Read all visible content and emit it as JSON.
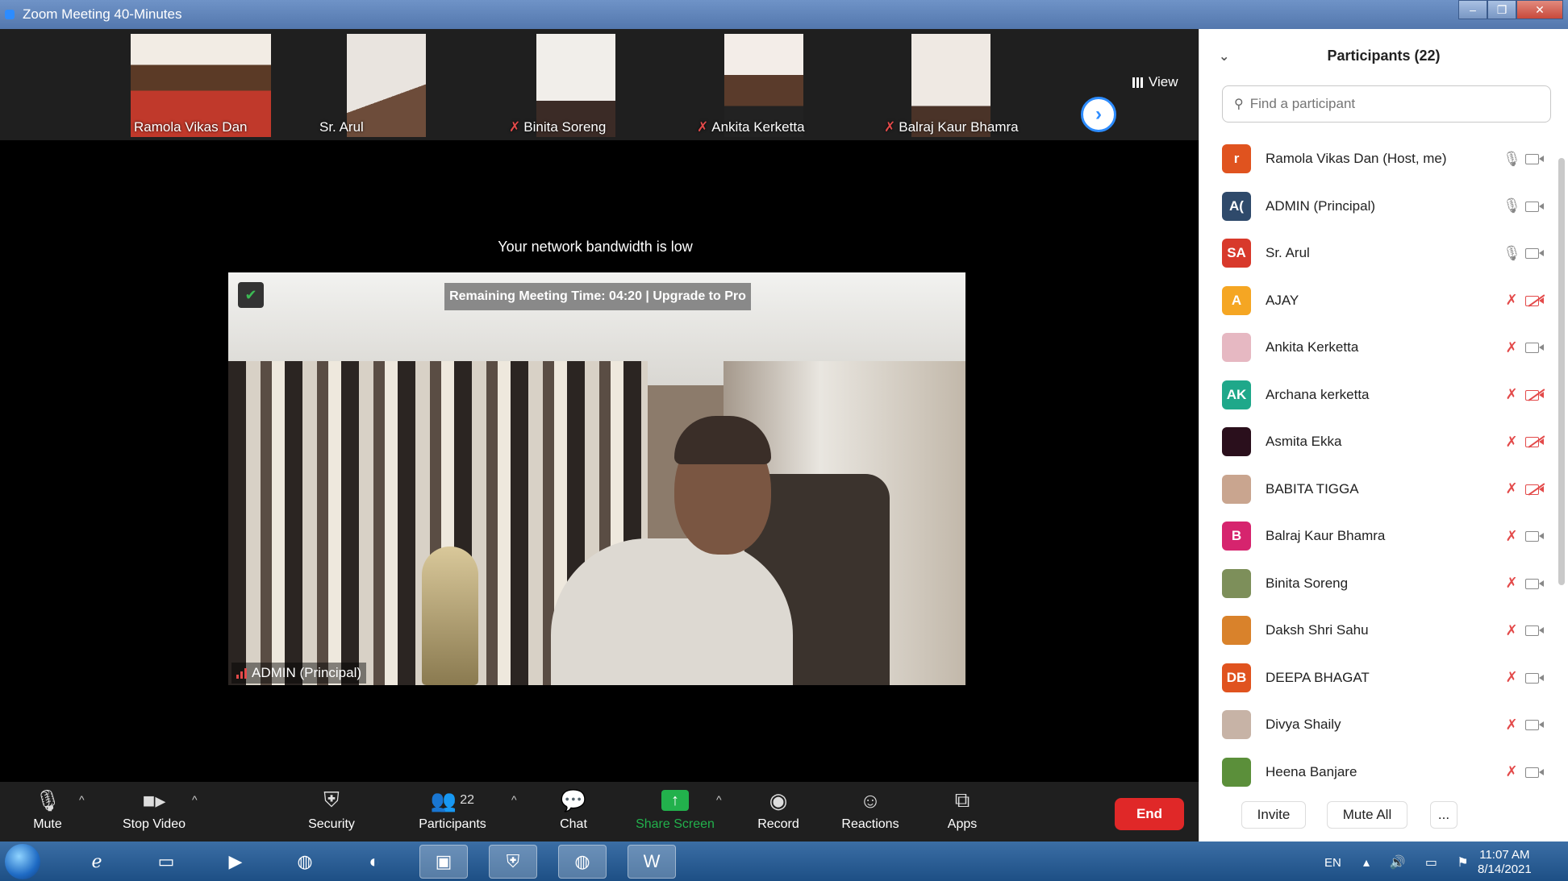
{
  "window": {
    "title": "Zoom Meeting 40-Minutes",
    "controls": [
      "–",
      "❐",
      "✕"
    ]
  },
  "gallery": {
    "tiles": [
      {
        "name": "Ramola  Vikas Dan",
        "muted": false
      },
      {
        "name": "Sr. Arul",
        "muted": false
      },
      {
        "name": "Binita Soreng",
        "muted": true
      },
      {
        "name": "Ankita Kerketta",
        "muted": true
      },
      {
        "name": "Balraj Kaur Bhamra",
        "muted": true
      }
    ],
    "view_label": "View"
  },
  "stage": {
    "bandwidth_notice": "Your network bandwidth is low",
    "remaining_time": "Remaining Meeting Time: 04:20 | Upgrade to Pro",
    "active_speaker": "ADMIN (Principal)"
  },
  "toolbar": {
    "mute": "Mute",
    "stop_video": "Stop Video",
    "security": "Security",
    "participants": "Participants",
    "participants_count": "22",
    "chat": "Chat",
    "share_screen": "Share Screen",
    "record": "Record",
    "reactions": "Reactions",
    "apps": "Apps",
    "end": "End"
  },
  "panel": {
    "title": "Participants (22)",
    "search_placeholder": "Find a participant",
    "participants": [
      {
        "initials": "r",
        "name": "Ramola  Vikas Dan (Host, me)",
        "color": "#e0531f",
        "mic": "on",
        "cam": "on"
      },
      {
        "initials": "A(",
        "name": "ADMIN (Principal)",
        "color": "#2f4a6b",
        "mic": "on",
        "cam": "on"
      },
      {
        "initials": "SA",
        "name": "Sr. Arul",
        "color": "#d8392b",
        "mic": "on",
        "cam": "on"
      },
      {
        "initials": "A",
        "name": "AJAY",
        "color": "#f5a623",
        "mic": "off",
        "cam": "off"
      },
      {
        "initials": "",
        "name": "Ankita Kerketta",
        "color": "#e6b8c2",
        "mic": "off",
        "cam": "on"
      },
      {
        "initials": "AK",
        "name": "Archana kerketta",
        "color": "#1fa88a",
        "mic": "off",
        "cam": "off"
      },
      {
        "initials": "",
        "name": "Asmita Ekka",
        "color": "#2a0f1c",
        "mic": "off",
        "cam": "off"
      },
      {
        "initials": "",
        "name": "BABITA TIGGA",
        "color": "#c9a58f",
        "mic": "off",
        "cam": "off"
      },
      {
        "initials": "B",
        "name": "Balraj Kaur Bhamra",
        "color": "#d6246e",
        "mic": "off",
        "cam": "on"
      },
      {
        "initials": "",
        "name": "Binita Soreng",
        "color": "#7d8f5a",
        "mic": "off",
        "cam": "on"
      },
      {
        "initials": "",
        "name": "Daksh Shri Sahu",
        "color": "#d9822b",
        "mic": "off",
        "cam": "on"
      },
      {
        "initials": "DB",
        "name": "DEEPA BHAGAT",
        "color": "#e0531f",
        "mic": "off",
        "cam": "on"
      },
      {
        "initials": "",
        "name": "Divya Shaily",
        "color": "#c7b3a6",
        "mic": "off",
        "cam": "on"
      },
      {
        "initials": "",
        "name": "Heena Banjare",
        "color": "#5b8f3a",
        "mic": "off",
        "cam": "on"
      }
    ],
    "invite": "Invite",
    "mute_all": "Mute All",
    "more": "..."
  },
  "taskbar": {
    "language": "EN",
    "time": "11:07 AM",
    "date": "8/14/2021"
  }
}
